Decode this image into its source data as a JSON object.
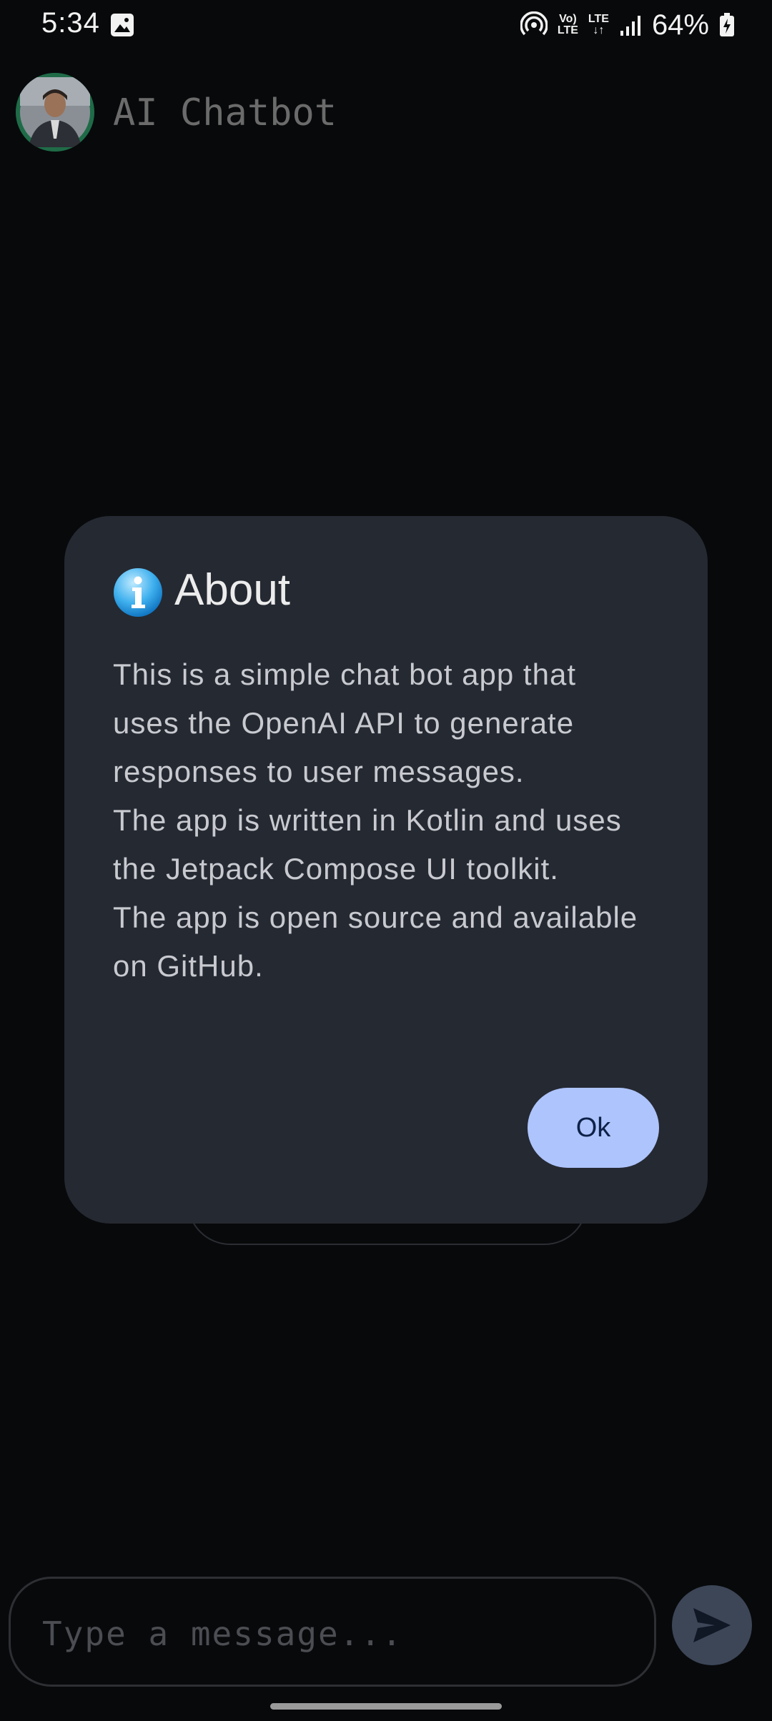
{
  "status_bar": {
    "time": "5:34",
    "battery": "64%",
    "volte_top": "Vo)",
    "volte_bottom": "LTE",
    "lte_top": "LTE",
    "lte_bottom": "↓↑"
  },
  "app_bar": {
    "title": "AI Chatbot"
  },
  "dialog": {
    "title": "About",
    "body": [
      "This is a simple chat bot app that uses the OpenAI API to generate responses to user messages.",
      "The app is written in Kotlin and uses the Jetpack Compose UI toolkit.",
      "The app is open source and available on GitHub."
    ],
    "ok_label": "Ok"
  },
  "composer": {
    "placeholder": "Type a message..."
  },
  "colors": {
    "dialog_bg": "#252932",
    "ok_button": "#aec4fd",
    "send_button": "#3c4657",
    "background": "#08090b"
  },
  "icons": {
    "info": "info-icon",
    "send": "send-icon",
    "gallery": "image-icon",
    "hotspot": "hotspot-icon",
    "signal": "signal-icon",
    "battery": "battery-charging-icon"
  }
}
